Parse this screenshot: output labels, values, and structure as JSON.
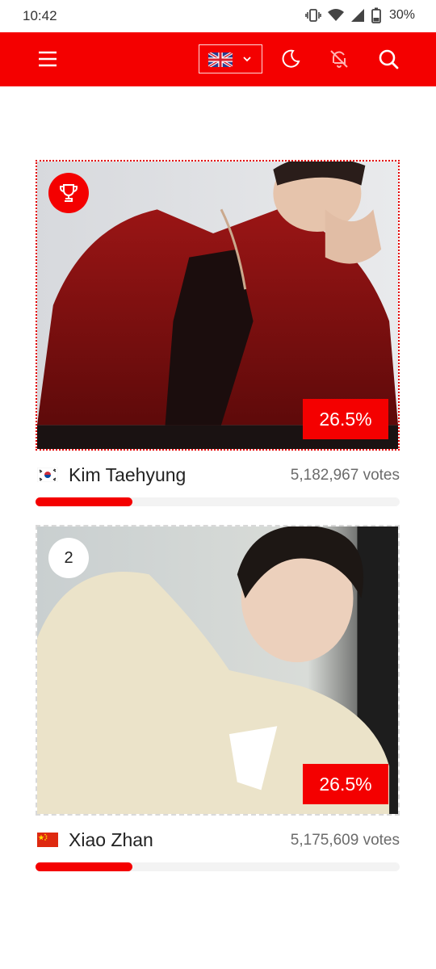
{
  "status_bar": {
    "time": "10:42",
    "battery": "30%"
  },
  "app_bar": {
    "icons": [
      "menu-icon",
      "uk-flag-icon",
      "chevron-down-icon",
      "moon-icon",
      "bell-off-icon",
      "search-icon"
    ],
    "accent_color": "#f40000"
  },
  "candidates": [
    {
      "rank": "1",
      "rank_icon": "trophy-icon",
      "name": "Kim Taehyung",
      "country_flag": "south-korea-flag-icon",
      "votes": "5,182,967 votes",
      "percent_label": "26.5%",
      "percent": 26.5
    },
    {
      "rank": "2",
      "rank_icon": "",
      "name": "Xiao Zhan",
      "country_flag": "china-flag-icon",
      "votes": "5,175,609 votes",
      "percent_label": "26.5%",
      "percent": 26.5
    }
  ]
}
